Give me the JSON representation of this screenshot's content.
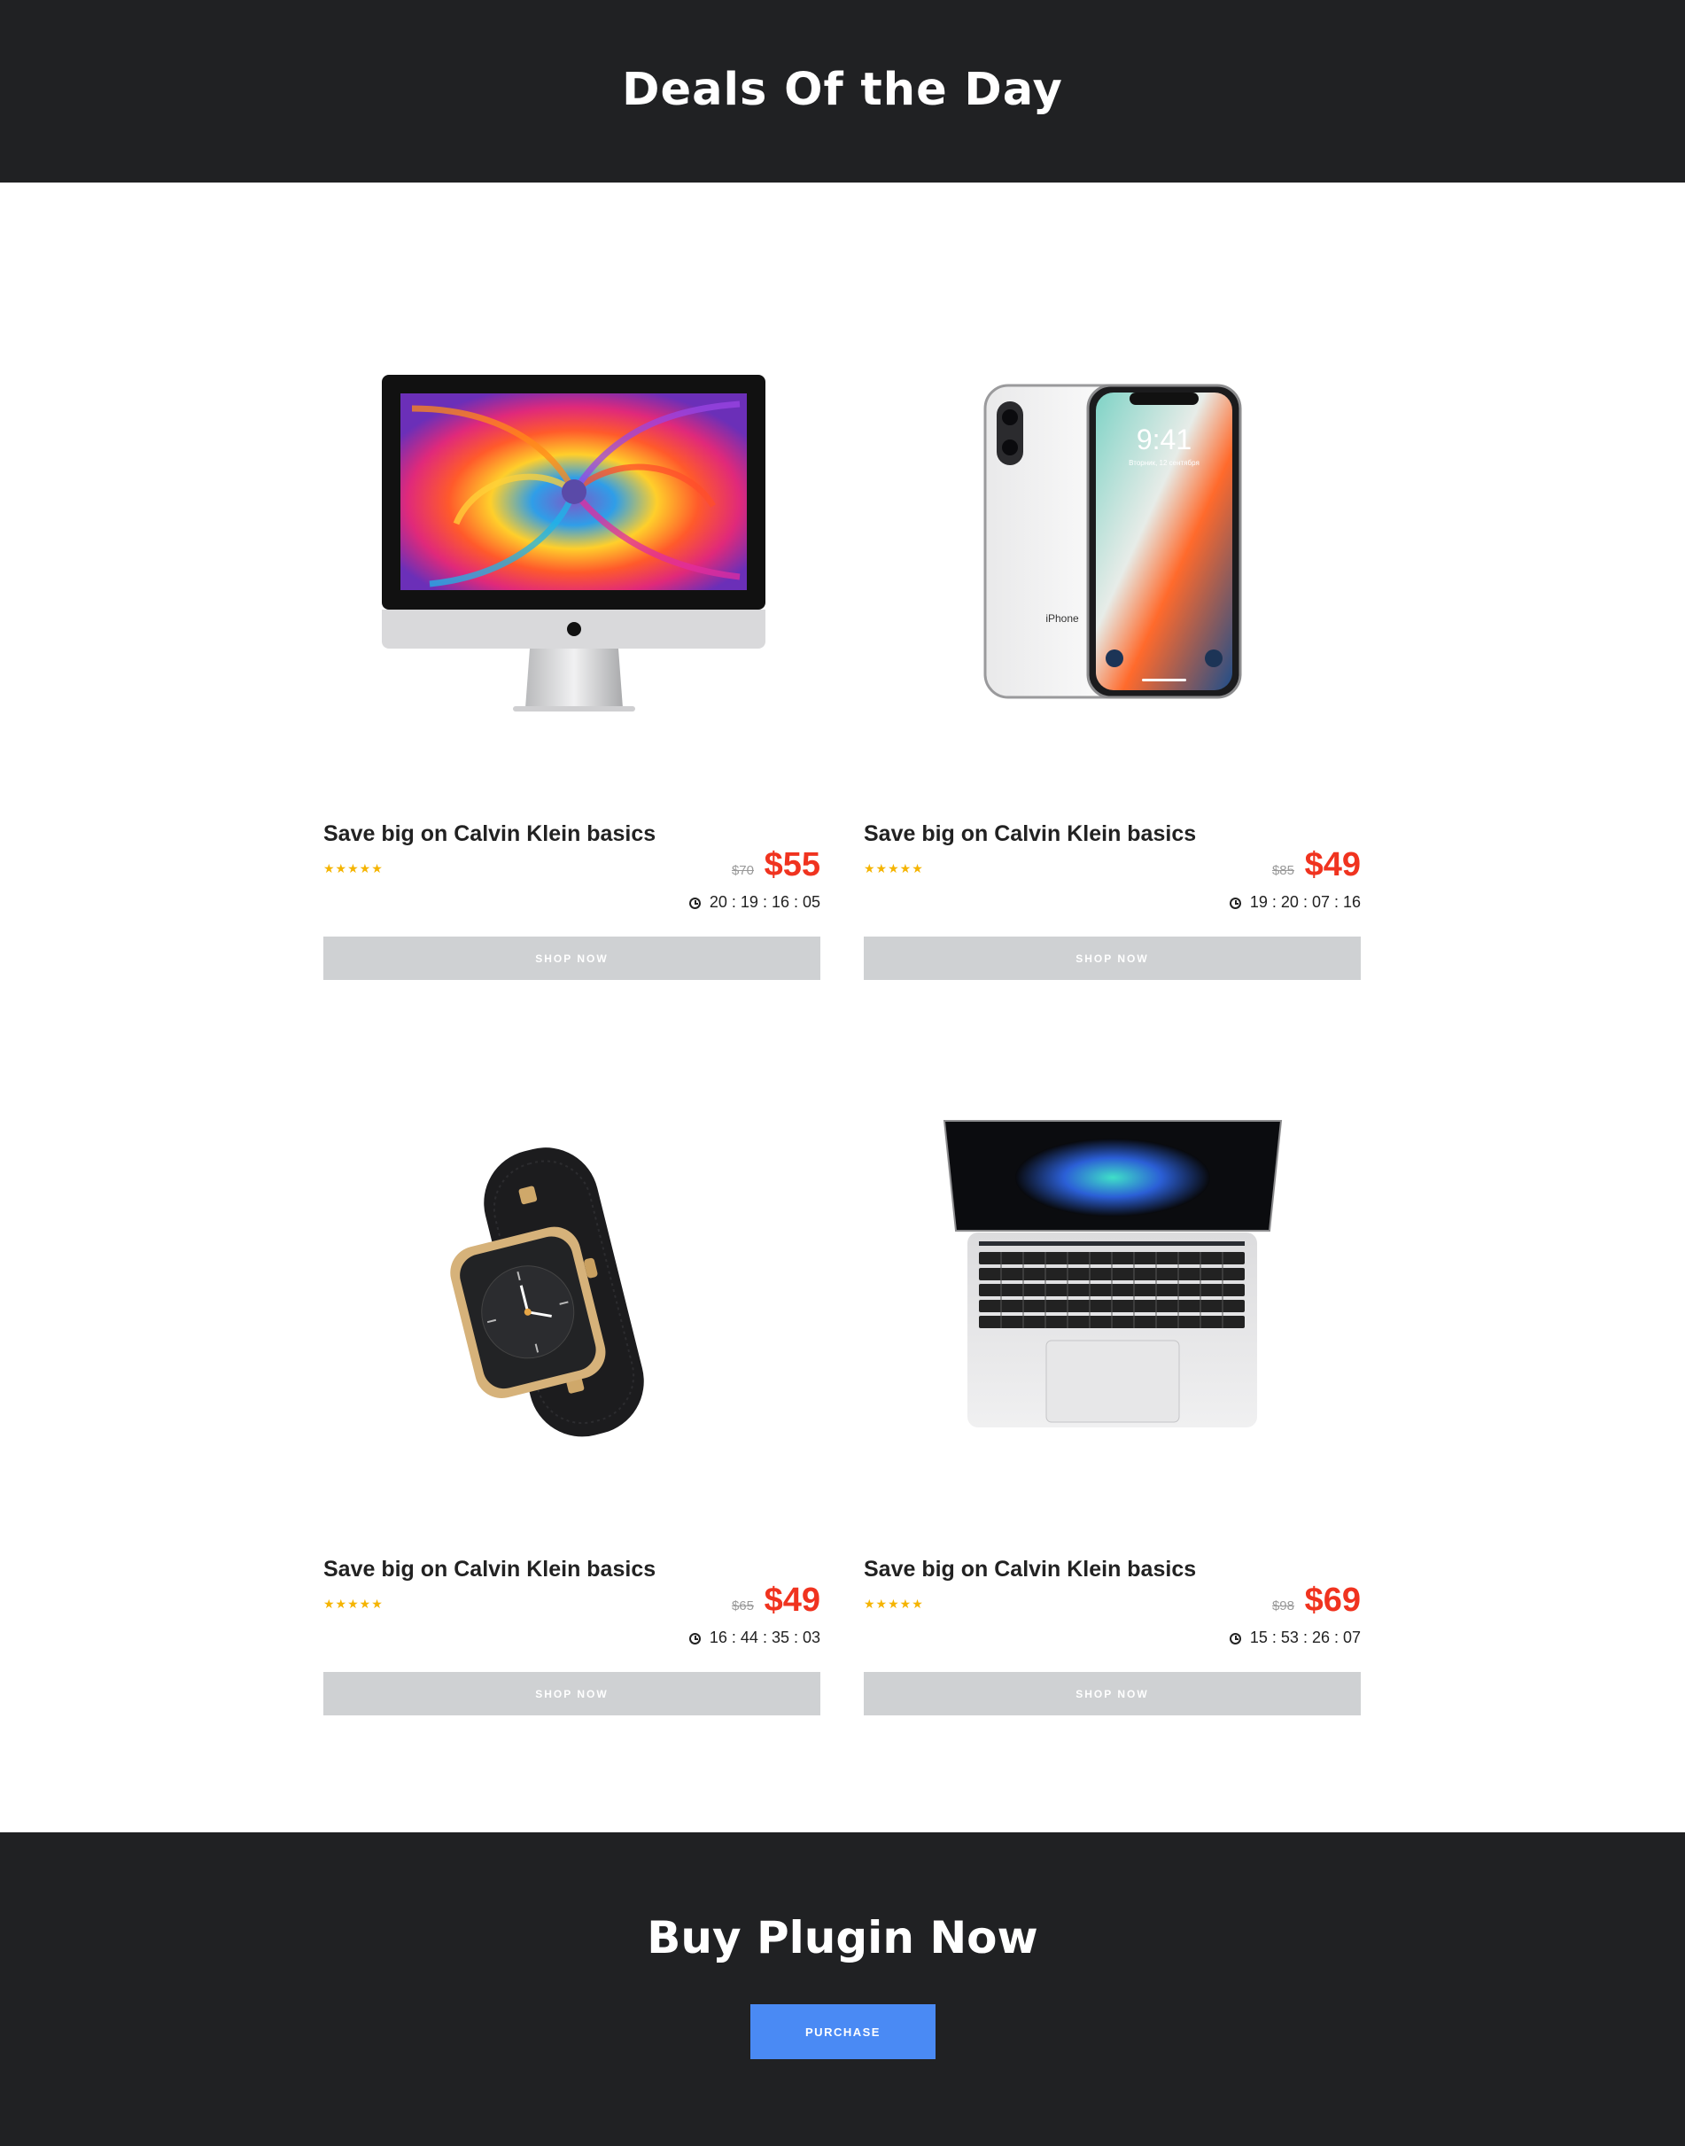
{
  "header": {
    "title": "Deals Of the Day"
  },
  "products": [
    {
      "image": "imac-image",
      "title": "Save big on Calvin Klein basics",
      "rating": "★★★★★",
      "old_price": "$70",
      "price": "$55",
      "countdown": "20 : 19 : 16 : 05",
      "button": "SHOP NOW"
    },
    {
      "image": "iphone-image",
      "title": "Save big on Calvin Klein basics",
      "rating": "★★★★★",
      "old_price": "$85",
      "price": "$49",
      "countdown": "19 : 20 : 07 : 16",
      "button": "SHOP NOW"
    },
    {
      "image": "apple-watch-image",
      "title": "Save big on Calvin Klein basics",
      "rating": "★★★★★",
      "old_price": "$65",
      "price": "$49",
      "countdown": "16 : 44 : 35 : 03",
      "button": "SHOP NOW"
    },
    {
      "image": "macbook-image",
      "title": "Save big on Calvin Klein basics",
      "rating": "★★★★★",
      "old_price": "$98",
      "price": "$69",
      "countdown": "15 : 53 : 26 : 07",
      "button": "SHOP NOW"
    }
  ],
  "iphone_screen": {
    "time": "9:41",
    "date": "Вторник, 12 сентября",
    "label": "iPhone"
  },
  "footer": {
    "title": "Buy Plugin Now",
    "button": "PURCHASE"
  },
  "colors": {
    "dark_background": "#202123",
    "accent_price": "#f0331f",
    "star": "#f5b400",
    "button_grey": "#cfd1d3",
    "purchase_blue": "#4a8af4"
  }
}
